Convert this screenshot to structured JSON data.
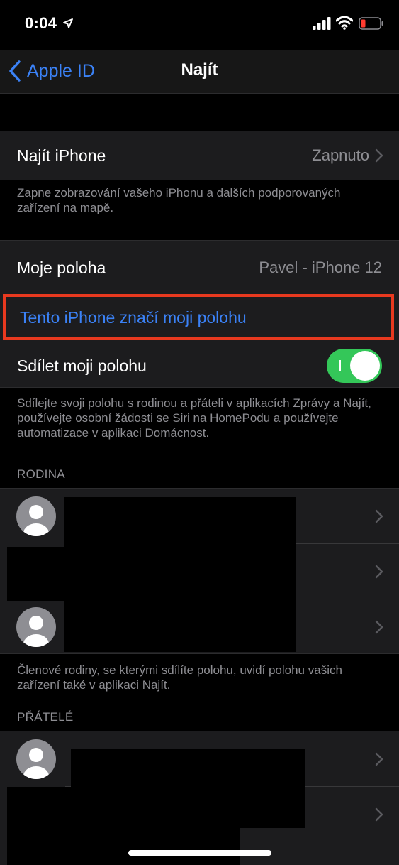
{
  "status_bar": {
    "time": "0:04"
  },
  "nav": {
    "back_label": "Apple ID",
    "title": "Najít"
  },
  "find_iphone": {
    "label": "Najít iPhone",
    "value": "Zapnuto",
    "footnote": "Zapne zobrazování vašeho iPhonu a dalších podporovaných zařízení na mapě."
  },
  "my_location": {
    "label": "Moje poloha",
    "value": "Pavel - iPhone 12",
    "use_this_iphone": "Tento iPhone značí moji polohu",
    "share_label": "Sdílet moji polohu",
    "share_enabled": true,
    "footnote": "Sdílejte svoji polohu s rodinou a přáteli v aplikacích Zprávy a Najít, používejte osobní žádosti se Siri na HomePodu a používejte automatizace v aplikaci Domácnost."
  },
  "family": {
    "header": "RODINA",
    "footnote": "Členové rodiny, se kterými sdílíte polohu, uvidí polohu vašich zařízení také v aplikaci Najít."
  },
  "friends": {
    "header": "PŘÁTELÉ"
  },
  "colors": {
    "accent": "#3b82f7",
    "toggle_on": "#34c759",
    "highlight_border": "#e8391f"
  }
}
